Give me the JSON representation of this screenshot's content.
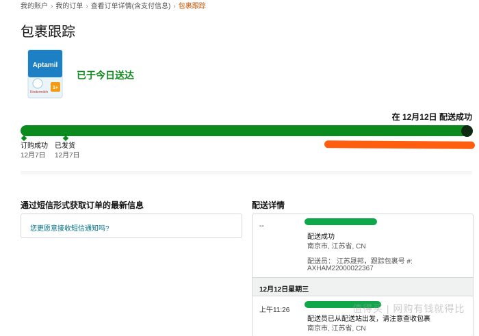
{
  "breadcrumb": {
    "items": [
      "我的账户",
      "我的订单",
      "查看订单详情(含支付信息)"
    ],
    "current": "包裹跟踪",
    "separator": "›"
  },
  "page_title": "包裹跟踪",
  "product": {
    "brand": "Aptamil",
    "label": "Kindermilch",
    "badge": "1+"
  },
  "status": "已于今日送达",
  "progress": {
    "delivered_text": "在 12月12日 配送成功",
    "fill_fraction": 1.0,
    "milestones": [
      {
        "label": "订购成功",
        "date": "12月7日"
      },
      {
        "label": "已发货",
        "date": "12月7日"
      }
    ]
  },
  "sms": {
    "heading": "通过短信形式获取订单的最新信息",
    "link": "您更愿意接收短信通知吗?"
  },
  "detail": {
    "heading": "配送详情",
    "events": [
      {
        "time": "--",
        "status": "配送成功",
        "location": "南京市, 江苏省, CN",
        "courier": "配送员：  江苏晟邦，跟踪包裹号 #:",
        "tracking": "AXHAM22000022367"
      }
    ],
    "day_header": "12月12日星期三",
    "events2": [
      {
        "time": "上午11:26",
        "status": "配送员已从配送站出发，请注意查收包裹",
        "location": "南京市, 江苏省, CN"
      }
    ]
  },
  "watermark": "值得买 | 网购有钱就得比",
  "colors": {
    "accent_green": "#0b8a1e",
    "link_blue": "#007185",
    "breadcrumb_current": "#c45500"
  }
}
